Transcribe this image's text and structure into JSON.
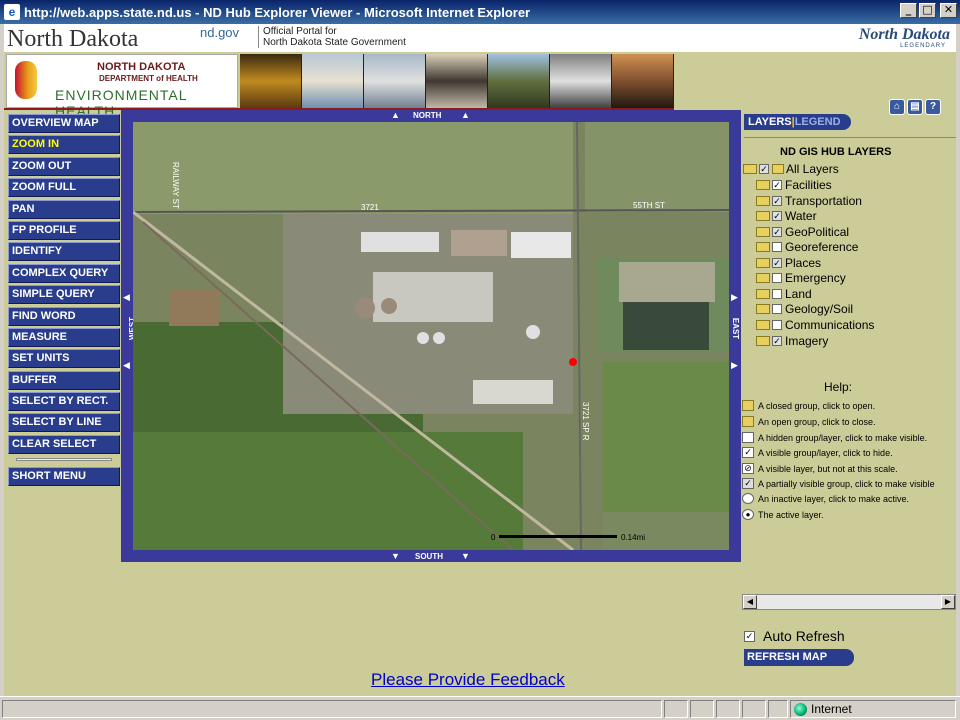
{
  "window": {
    "title": "http://web.apps.state.nd.us - ND Hub Explorer Viewer - Microsoft Internet Explorer",
    "min": "_",
    "max": "□",
    "close": "✕"
  },
  "header": {
    "state_title": "North Dakota",
    "ndgov": "nd.gov",
    "portal_line1": "Official Portal for",
    "portal_line2": "North Dakota State Government",
    "logo_script": "North Dakota",
    "logo_sub": "LEGENDARY",
    "health_line1": "NORTH DAKOTA",
    "health_line2": "DEPARTMENT of HEALTH",
    "health_line3": "ENVIRONMENTAL HEALTH",
    "top_icons": [
      "home-icon",
      "print-icon",
      "help-icon"
    ]
  },
  "menu": {
    "items": [
      "OVERVIEW MAP",
      "ZOOM IN",
      "ZOOM OUT",
      "ZOOM FULL",
      "PAN",
      "FP PROFILE",
      "IDENTIFY",
      "COMPLEX QUERY",
      "SIMPLE QUERY",
      "FIND WORD",
      "MEASURE",
      "SET UNITS",
      "BUFFER",
      "SELECT BY RECT.",
      "SELECT BY LINE",
      "CLEAR SELECT"
    ],
    "active": "ZOOM IN",
    "short_menu": "SHORT MENU"
  },
  "map": {
    "north": "NORTH",
    "south": "SOUTH",
    "east": "EAST",
    "west": "WEST",
    "road_labels": [
      "3721",
      "55TH ST",
      "3721 SP R",
      "RAILWAY ST"
    ],
    "scale_start": "0",
    "scale_end": "0.14mi"
  },
  "layers_panel": {
    "tab_layers": "LAYERS",
    "tab_sep": "|",
    "tab_legend": "LEGEND",
    "title": "ND GIS HUB LAYERS",
    "all_layers": "All Layers",
    "items": [
      "Facilities",
      "Transportation",
      "Water",
      "GeoPolitical",
      "Georeference",
      "Places",
      "Emergency",
      "Land",
      "Geology/Soil",
      "Communications",
      "Imagery"
    ]
  },
  "help": {
    "title": "Help:",
    "lines": [
      "A closed group, click to open.",
      "An open group, click to close.",
      "A hidden group/layer, click to make visible.",
      "A visible group/layer, click to hide.",
      "A visible layer, but not at this scale.",
      "A partially visible group, click to make visible",
      "An inactive layer, click to make active.",
      "The active layer."
    ]
  },
  "controls": {
    "auto_refresh": "Auto Refresh",
    "refresh_map": "REFRESH MAP"
  },
  "feedback": "Please Provide Feedback",
  "status": {
    "zone": "Internet"
  }
}
